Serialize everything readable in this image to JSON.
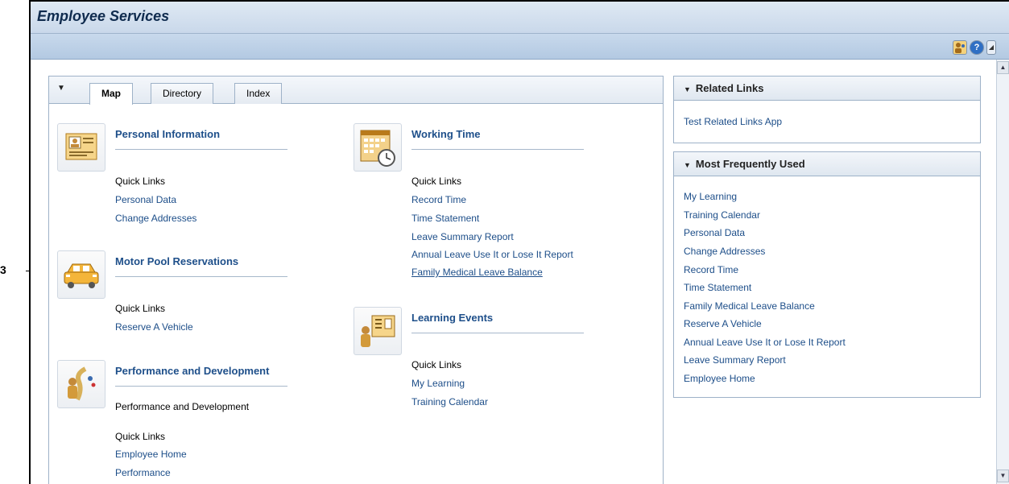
{
  "app": {
    "title": "Employee Services"
  },
  "toolbar": {
    "person_icon": "person-icon",
    "help_icon": "help-icon",
    "menu_icon": "menu-arrow-icon",
    "help_glyph": "?",
    "menu_glyph": "◢"
  },
  "callout": {
    "number": "3"
  },
  "tabs": [
    {
      "label": "Map",
      "active": true
    },
    {
      "label": "Directory",
      "active": false
    },
    {
      "label": "Index",
      "active": false
    }
  ],
  "areas": {
    "personal": {
      "title": "Personal Information",
      "quick_links_label": "Quick Links",
      "links": [
        "Personal Data",
        "Change Addresses"
      ]
    },
    "motor": {
      "title": "Motor Pool Reservations",
      "quick_links_label": "Quick Links",
      "links": [
        "Reserve A Vehicle"
      ]
    },
    "performance": {
      "title": "Performance and Development",
      "subtitle": "Performance and Development",
      "quick_links_label": "Quick Links",
      "links": [
        "Employee Home",
        "Performance"
      ]
    },
    "working": {
      "title": "Working Time",
      "quick_links_label": "Quick Links",
      "links": [
        "Record Time",
        "Time Statement",
        "Leave Summary Report",
        "Annual Leave Use It or Lose It Report",
        "Family Medical Leave Balance"
      ]
    },
    "learning": {
      "title": "Learning Events",
      "quick_links_label": "Quick Links",
      "links": [
        "My Learning",
        "Training Calendar"
      ]
    }
  },
  "related_links": {
    "title": "Related Links",
    "links": [
      "Test Related Links App"
    ]
  },
  "most_used": {
    "title": "Most Frequently Used",
    "links": [
      "My Learning",
      "Training Calendar",
      "Personal Data",
      "Change Addresses",
      "Record Time",
      "Time Statement",
      "Family Medical Leave Balance",
      "Reserve A Vehicle",
      "Annual Leave Use It or Lose It Report",
      "Leave Summary Report",
      "Employee Home"
    ]
  },
  "colors": {
    "link": "#1d4e89",
    "title_bar": "#c9d8ea",
    "area_title": "#1e4f8a"
  }
}
